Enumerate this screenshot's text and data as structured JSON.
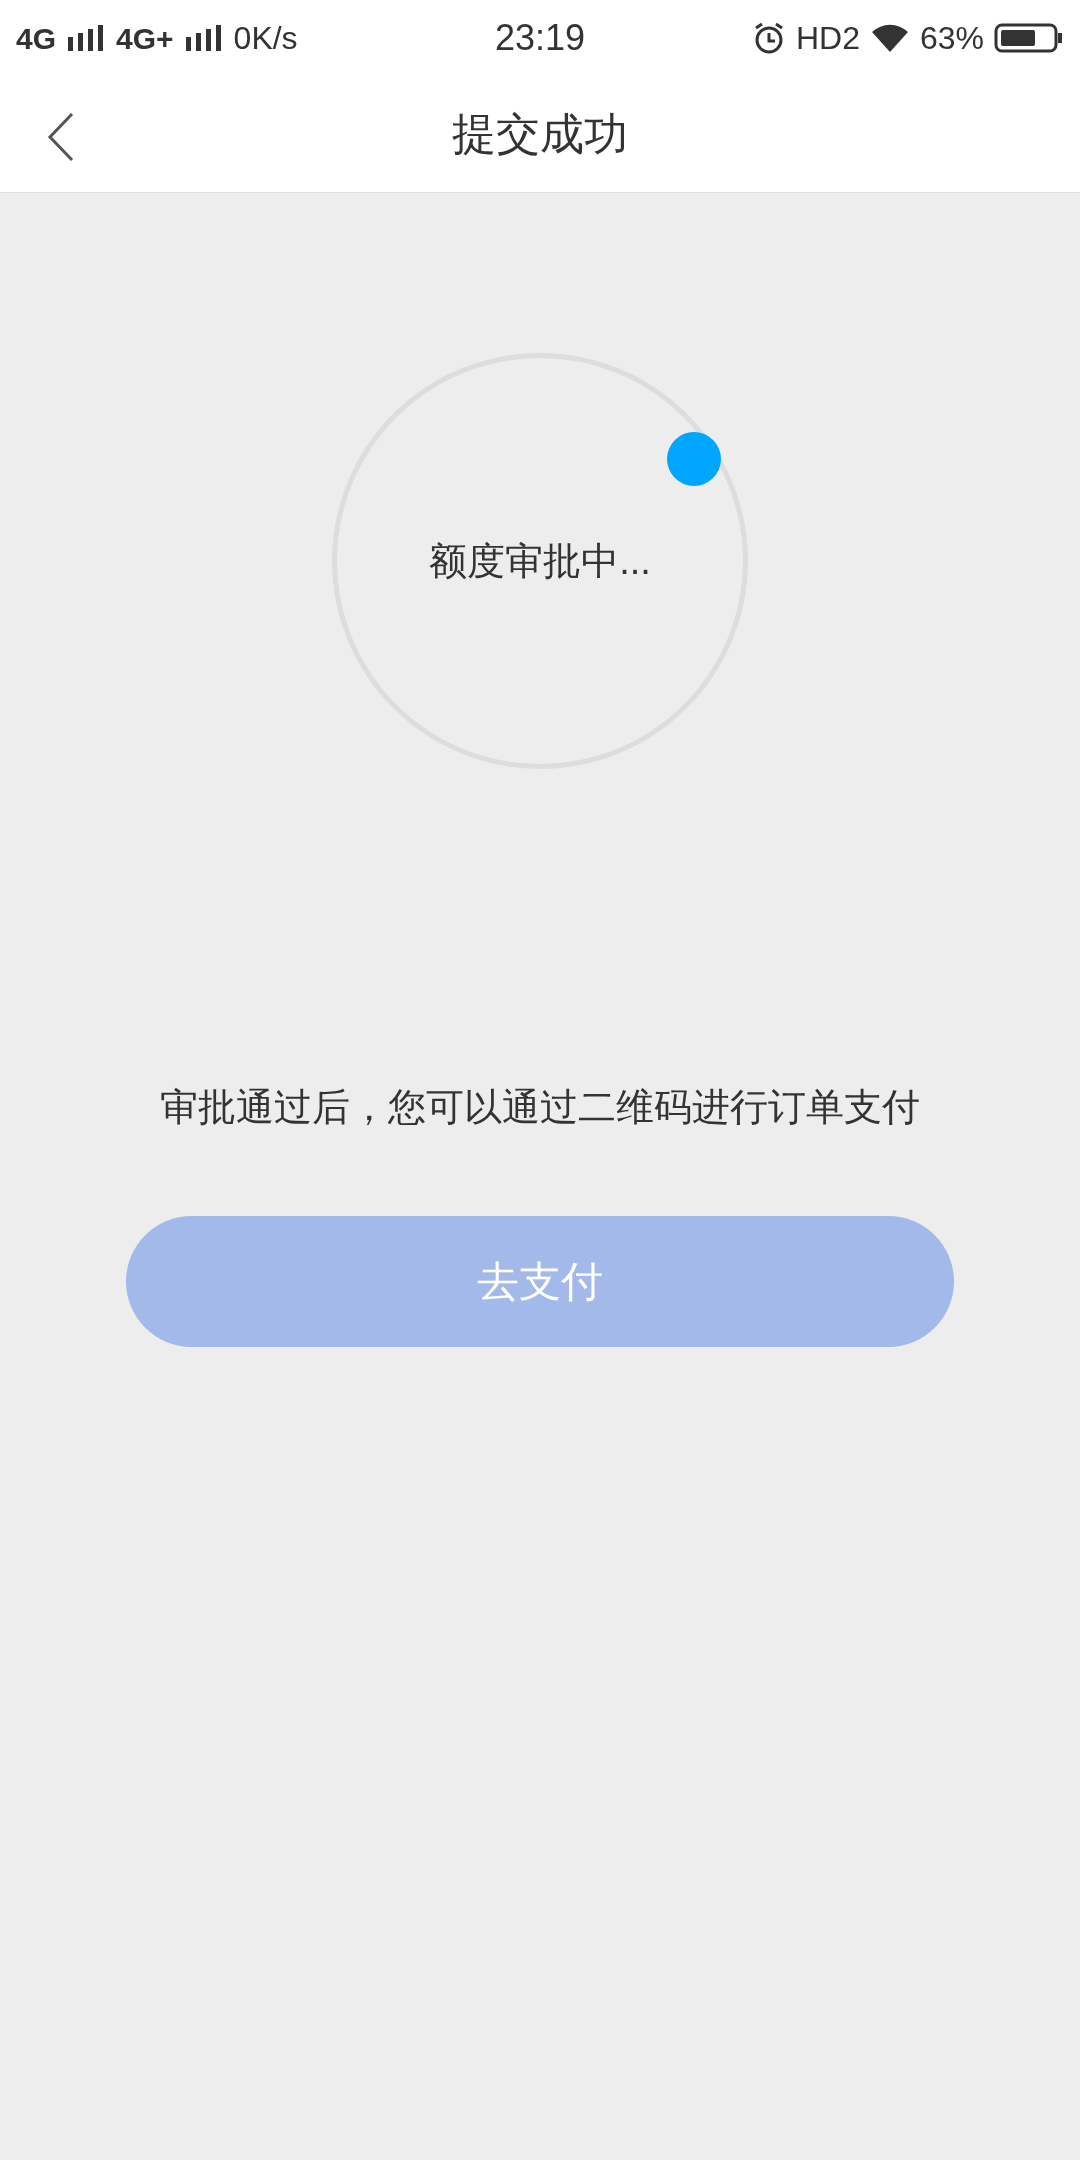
{
  "status_bar": {
    "network_1": "4G",
    "network_2": "4G+",
    "speed": "0K/s",
    "time": "23:19",
    "hd": "HD2",
    "battery": "63%"
  },
  "header": {
    "title": "提交成功"
  },
  "spinner": {
    "label": "额度审批中..."
  },
  "message": "审批通过后，您可以通过二维码进行订单支付",
  "pay_button": {
    "label": "去支付",
    "disabled": true
  }
}
